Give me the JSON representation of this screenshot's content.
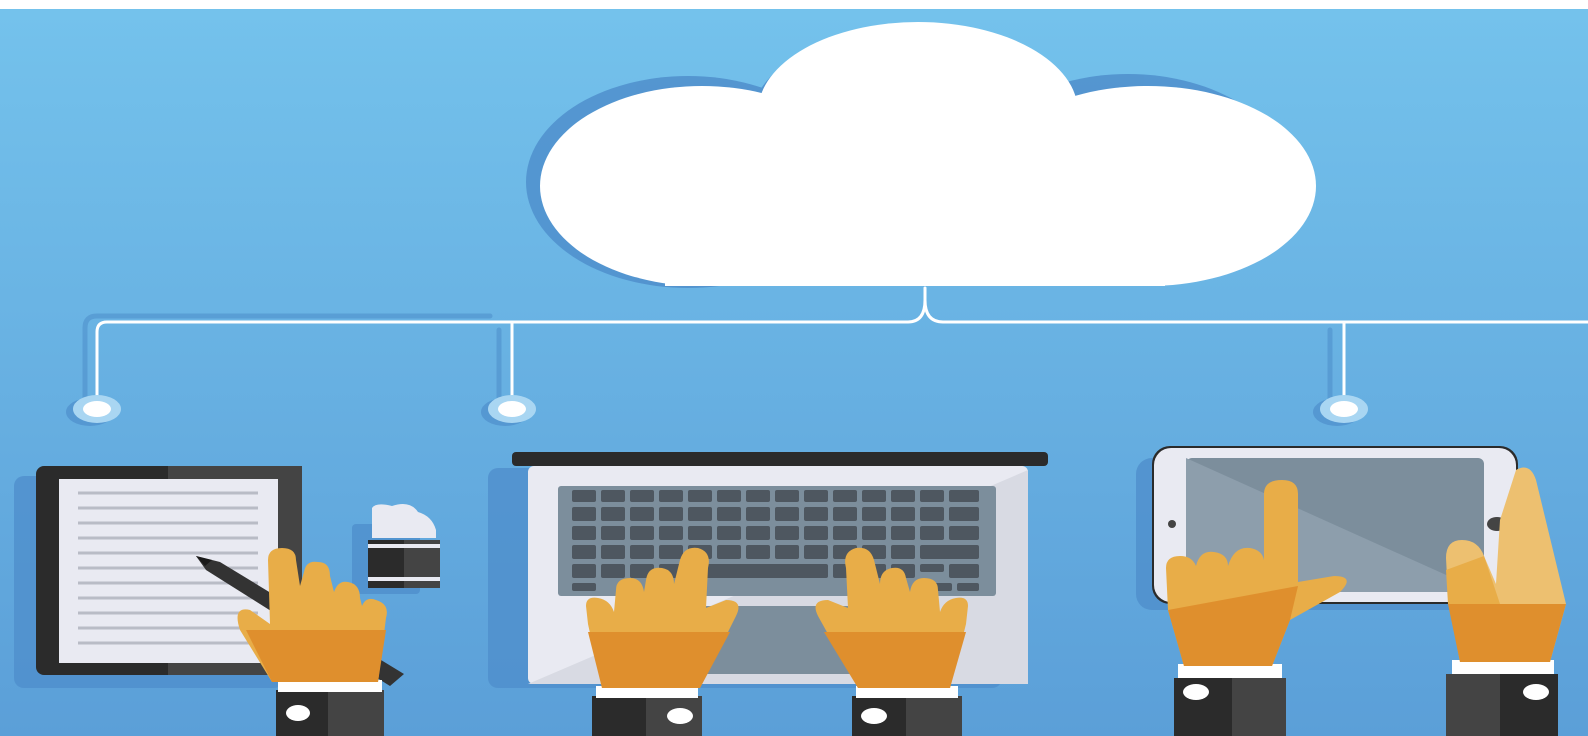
{
  "illustration": {
    "subject": "cloud-computing-devices",
    "cloud_caption": "",
    "colors": {
      "sky_top": "#74c2ec",
      "sky_bottom": "#5b9fd8",
      "cloud": "#ffffff",
      "shadow": "#4f8fcc",
      "skin": "#e8ad48",
      "skin_shade": "#df8f2d",
      "sleeve": "#333333",
      "device_dark": "#2b2b2b",
      "device_light": "#e9eaf2",
      "screen_gray": "#7c8e9c"
    },
    "devices": [
      "tablet-with-stylus",
      "laptop",
      "smartphone-landscape"
    ]
  }
}
